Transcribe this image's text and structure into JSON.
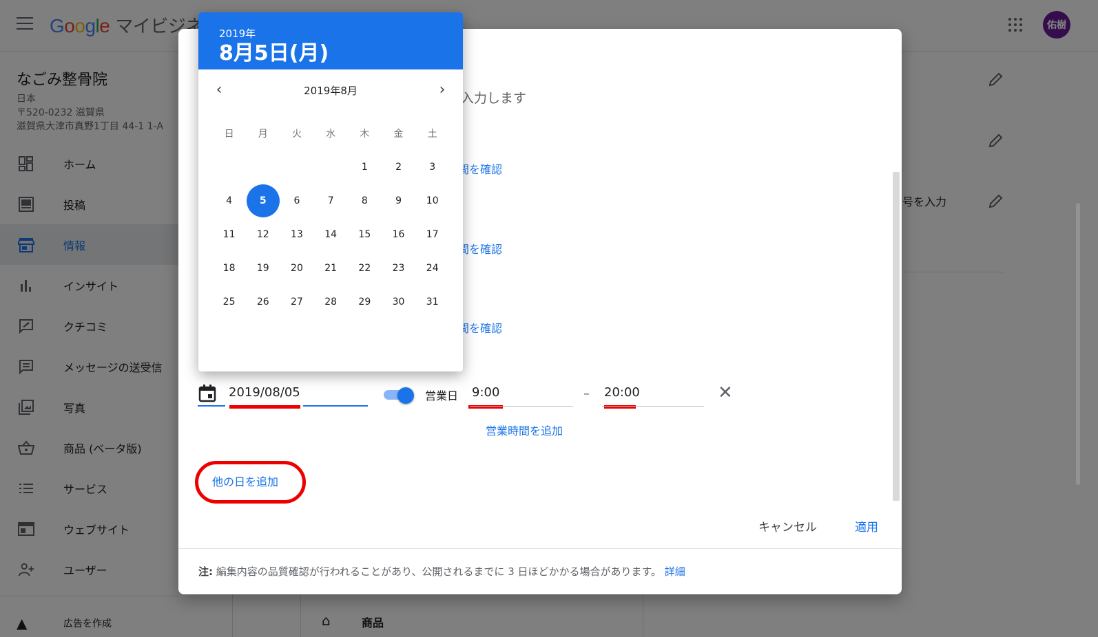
{
  "header": {
    "logo_letters": [
      "G",
      "o",
      "o",
      "g",
      "l",
      "e"
    ],
    "product": "マイビジネス",
    "avatar_text": "佑樹"
  },
  "business": {
    "name": "なごみ整骨院",
    "country": "日本",
    "postal": "〒520-0232 滋賀県",
    "address": "滋賀県大津市真野1丁目 44-1 1-A"
  },
  "sidebar": {
    "items": [
      {
        "label": "ホーム",
        "icon": "dashboard-icon"
      },
      {
        "label": "投稿",
        "icon": "posts-icon"
      },
      {
        "label": "情報",
        "icon": "store-icon",
        "active": true
      },
      {
        "label": "インサイト",
        "icon": "bar-chart-icon"
      },
      {
        "label": "クチコミ",
        "icon": "review-icon"
      },
      {
        "label": "メッセージの送受信",
        "icon": "message-icon"
      },
      {
        "label": "写真",
        "icon": "photo-icon"
      },
      {
        "label": "商品 (ベータ版)",
        "icon": "basket-icon"
      },
      {
        "label": "サービス",
        "icon": "list-icon"
      },
      {
        "label": "ウェブサイト",
        "icon": "website-icon"
      },
      {
        "label": "ユーザー",
        "icon": "add-user-icon"
      }
    ],
    "ads_label": "広告を作成"
  },
  "background": {
    "right_partial_text": "号を入力",
    "bottom_label": "商品"
  },
  "dialog": {
    "partial_placeholder": "入力します",
    "partial_links": [
      "間を確認",
      "間を確認",
      "間を確認"
    ],
    "date_value": "2019/08/05",
    "open_label": "営業日",
    "time_open": "9:00",
    "dash": "–",
    "time_close": "20:00",
    "close_glyph": "✕",
    "add_hours": "営業時間を追加",
    "add_day": "他の日を追加",
    "cancel": "キャンセル",
    "apply": "適用",
    "footer_note_label": "注:",
    "footer_note": " 編集内容の品質確認が行われることがあり、公開されるまでに 3 日ほどかかる場合があります。",
    "footer_link": "詳細"
  },
  "picker": {
    "year": "2019年",
    "selected_label": "8月5日(月)",
    "month_label": "2019年8月",
    "prev_glyph": "‹",
    "next_glyph": "›",
    "weekdays": [
      "日",
      "月",
      "火",
      "水",
      "木",
      "金",
      "土"
    ],
    "leading_blanks": 4,
    "days_in_month": 31,
    "selected_day": 5
  },
  "colors": {
    "accent": "#1a73e8",
    "highlight": "#e00000",
    "avatar": "#6a1b9a"
  }
}
